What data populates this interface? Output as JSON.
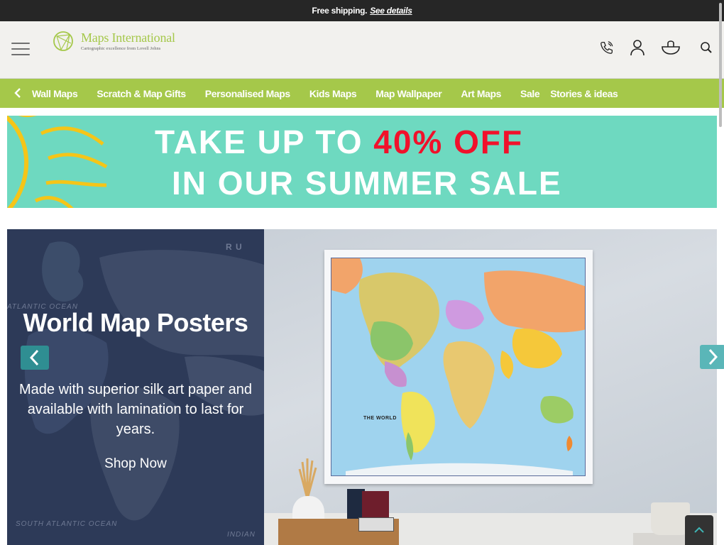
{
  "announcement": {
    "text": "Free shipping.",
    "link": "See details"
  },
  "header": {
    "logo": {
      "title": "Maps International",
      "subtitle": "Cartographic excellence from Lovell Johns"
    },
    "icons": [
      "phone-icon",
      "account-icon",
      "basket-icon",
      "search-icon"
    ]
  },
  "nav": {
    "items": [
      {
        "label": "Wall Maps"
      },
      {
        "label": "Scratch & Map Gifts"
      },
      {
        "label": "Personalised Maps"
      },
      {
        "label": "Kids Maps"
      },
      {
        "label": "Map Wallpaper"
      },
      {
        "label": "Art Maps"
      },
      {
        "label": "Sale"
      },
      {
        "label": "Stories & ideas"
      }
    ]
  },
  "sale_banner": {
    "line1_prefix": "TAKE UP TO",
    "line1_highlight": "40% OFF",
    "line2": "IN OUR SUMMER SALE",
    "colors": {
      "background": "#6ed9c0",
      "highlight": "#f1112b",
      "sun": "#f5c518"
    }
  },
  "hero": {
    "title": "World Map Posters",
    "description": "Made with superior silk art paper and available with lamination to last for years.",
    "cta": "Shop Now",
    "background_labels": {
      "atlantic": "ATLANTIC OCEAN",
      "south_atlantic": "SOUTH ATLANTIC OCEAN",
      "indian": "INDIAN",
      "ru": "R U"
    },
    "map_title": "THE WORLD"
  },
  "colors": {
    "announcement_bg": "#262626",
    "header_bg": "#f2f1ee",
    "nav_bg": "#a5c84a",
    "carousel_arrow": "#2f8e92",
    "back_to_top_bg": "#333333"
  }
}
